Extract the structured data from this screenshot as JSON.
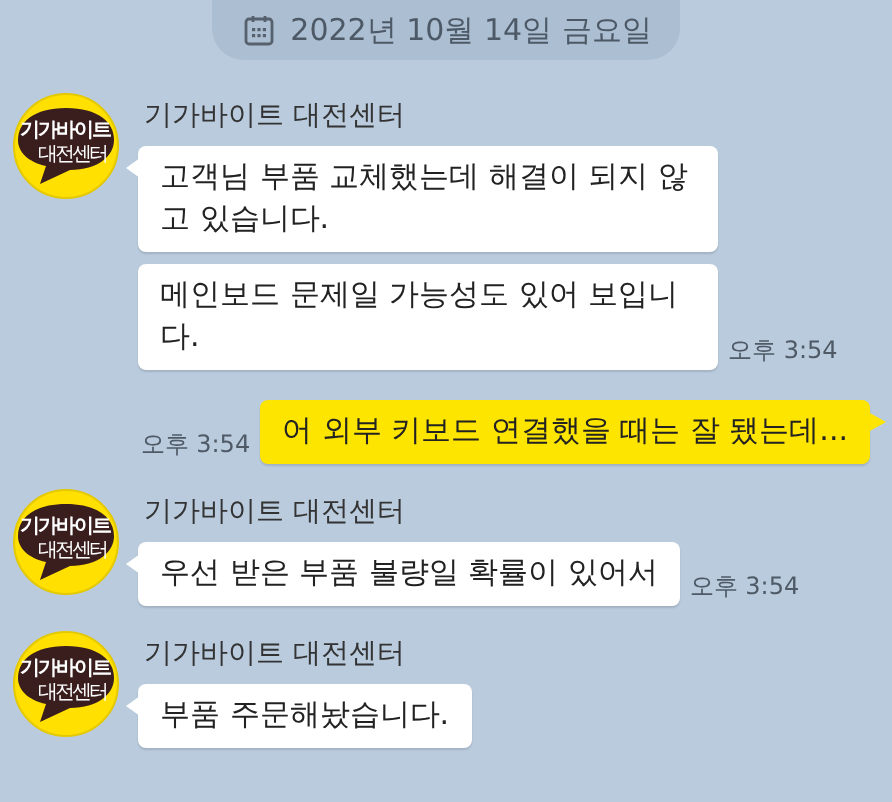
{
  "date_divider": {
    "text": "2022년 10월 14일 금요일"
  },
  "messages": [
    {
      "kind": "received",
      "sender": "기가바이트 대전센터",
      "avatar": {
        "lines": [
          "기가바이트",
          "대전센터"
        ]
      },
      "bubbles": [
        {
          "text": "고객님 부품 교체했는데 해결이 되지 않고 있습니다."
        },
        {
          "text": "메인보드 문제일 가능성도 있어 보입니다.",
          "time": "오후 3:54"
        }
      ]
    },
    {
      "kind": "sent",
      "bubbles": [
        {
          "text": "어 외부 키보드 연결했을 때는 잘 됐는데...",
          "time": "오후 3:54"
        }
      ]
    },
    {
      "kind": "received",
      "sender": "기가바이트 대전센터",
      "avatar": {
        "lines": [
          "기가바이트",
          "대전센터"
        ]
      },
      "bubbles": [
        {
          "text": "우선 받은 부품 불량일 확률이 있어서",
          "time": "오후 3:54"
        }
      ]
    },
    {
      "kind": "received",
      "sender": "기가바이트 대전센터",
      "avatar": {
        "lines": [
          "기가바이트",
          "대전센터"
        ]
      },
      "bubbles": [
        {
          "text": "부품 주문해놨습니다."
        }
      ]
    }
  ]
}
